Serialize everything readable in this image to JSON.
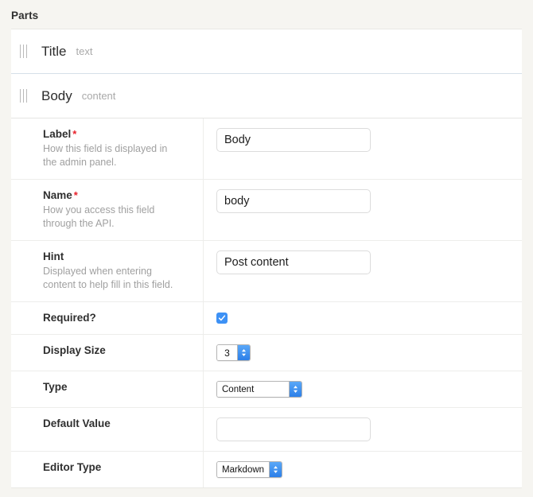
{
  "page": {
    "title": "Parts"
  },
  "parts": [
    {
      "name": "Title",
      "type": "text",
      "handle_icon": "drag-handle-icon"
    },
    {
      "name": "Body",
      "type": "content",
      "handle_icon": "drag-handle-icon"
    }
  ],
  "settings": {
    "rows": [
      {
        "key": "label",
        "label": "Label",
        "required_marker": "*",
        "help": "How this field is displayed in the admin panel.",
        "control": "text",
        "value": "Body",
        "placeholder": ""
      },
      {
        "key": "name",
        "label": "Name",
        "required_marker": "*",
        "help": "How you access this field through the API.",
        "control": "text",
        "value": "body",
        "placeholder": ""
      },
      {
        "key": "hint",
        "label": "Hint",
        "required_marker": "",
        "help": "Displayed when entering content to help fill in this field.",
        "control": "text",
        "value": "Post content",
        "placeholder": ""
      },
      {
        "key": "required",
        "label": "Required?",
        "required_marker": "",
        "help": "",
        "control": "checkbox",
        "checked": true
      },
      {
        "key": "display_size",
        "label": "Display Size",
        "required_marker": "",
        "help": "",
        "control": "stepper",
        "value": "3"
      },
      {
        "key": "type",
        "label": "Type",
        "required_marker": "",
        "help": "",
        "control": "select",
        "value": "Content",
        "options": [
          "Content"
        ]
      },
      {
        "key": "default_value",
        "label": "Default Value",
        "required_marker": "",
        "help": "",
        "control": "text",
        "value": "",
        "placeholder": ""
      },
      {
        "key": "editor_type",
        "label": "Editor Type",
        "required_marker": "",
        "help": "",
        "control": "select",
        "value": "Markdown",
        "options": [
          "Markdown"
        ]
      }
    ]
  },
  "colors": {
    "page_background": "#f6f5f1",
    "card_background": "#ffffff",
    "accent_blue": "#3d91f5",
    "required_red": "#e8212b",
    "divider_blue": "#d6dfe8",
    "divider_grey": "#ededeb",
    "muted_text": "#a0a0a0"
  }
}
